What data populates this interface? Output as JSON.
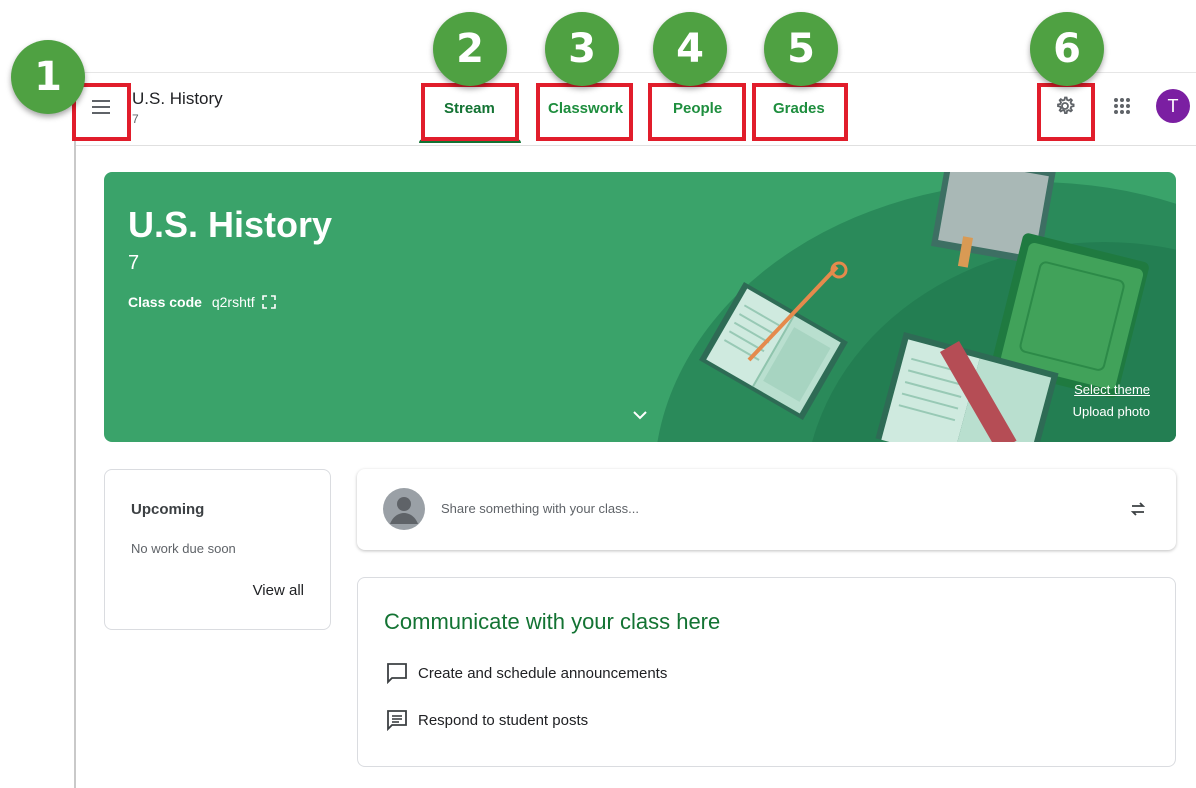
{
  "header": {
    "class_name": "U.S. History",
    "section": "7"
  },
  "tabs": [
    {
      "label": "Stream",
      "active": true
    },
    {
      "label": "Classwork"
    },
    {
      "label": "People"
    },
    {
      "label": "Grades"
    }
  ],
  "user": {
    "avatar_letter": "T"
  },
  "banner": {
    "title": "U.S. History",
    "section": "7",
    "class_code_label": "Class code",
    "class_code": "q2rshtf",
    "select_theme": "Select theme",
    "upload_photo": "Upload photo"
  },
  "upcoming": {
    "title": "Upcoming",
    "status": "No work due soon",
    "view_all": "View all"
  },
  "share": {
    "placeholder": "Share something with your class..."
  },
  "communicate": {
    "title": "Communicate with your class here",
    "items": [
      {
        "icon": "comment-icon",
        "label": "Create and schedule announcements"
      },
      {
        "icon": "posts-icon",
        "label": "Respond to student posts"
      }
    ]
  },
  "callouts": [
    "1",
    "2",
    "3",
    "4",
    "5",
    "6"
  ],
  "colors": {
    "banner": "#3aa36a",
    "accent": "#137333",
    "callout": "#4fa142",
    "highlight": "#e11d2b",
    "avatar": "#7b1fa2"
  }
}
